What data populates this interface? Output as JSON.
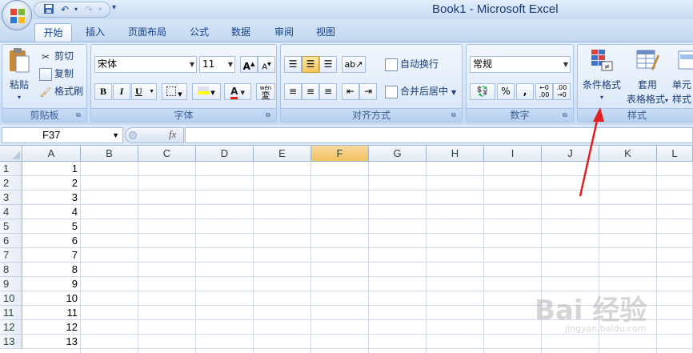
{
  "window": {
    "title": "Book1 - Microsoft Excel"
  },
  "quick_access": {
    "save_icon": "save-icon",
    "undo_icon": "undo-icon",
    "redo_icon": "redo-icon"
  },
  "tabs": [
    {
      "label": "开始",
      "active": true
    },
    {
      "label": "插入"
    },
    {
      "label": "页面布局"
    },
    {
      "label": "公式"
    },
    {
      "label": "数据"
    },
    {
      "label": "审阅"
    },
    {
      "label": "视图"
    }
  ],
  "clipboard": {
    "label": "剪贴板",
    "paste": "粘贴",
    "cut": "剪切",
    "copy": "复制",
    "format_painter": "格式刷"
  },
  "font": {
    "label": "字体",
    "name": "宋体",
    "size": "11",
    "bold": "B",
    "italic": "I",
    "underline": "U",
    "font_color_letter": "A",
    "grow": "A",
    "shrink": "A",
    "phonetic": "wén"
  },
  "alignment": {
    "label": "对齐方式",
    "wrap_text": "自动换行",
    "merge_center": "合并后居中"
  },
  "number": {
    "label": "数字",
    "format": "常规",
    "percent": "%",
    "comma": ",",
    "increase_decimal": ".00",
    "decrease_decimal": ".00"
  },
  "styles": {
    "label": "样式",
    "conditional_formatting": "条件格式",
    "format_table_line1": "套用",
    "format_table_line2": "表格格式",
    "cell_styles_line1": "单元",
    "cell_styles_line2": "样式"
  },
  "formula_bar": {
    "name_box": "F37",
    "fx": "fx",
    "value": ""
  },
  "grid": {
    "columns": [
      "A",
      "B",
      "C",
      "D",
      "E",
      "F",
      "G",
      "H",
      "I",
      "J",
      "K",
      "L"
    ],
    "selected_column": "F",
    "rows": [
      "1",
      "2",
      "3",
      "4",
      "5",
      "6",
      "7",
      "8",
      "9",
      "10",
      "11",
      "12",
      "13"
    ],
    "column_a_values": [
      "1",
      "2",
      "3",
      "4",
      "5",
      "6",
      "7",
      "8",
      "9",
      "10",
      "11",
      "12",
      "13"
    ]
  },
  "watermark": {
    "text": "Bai 经验",
    "sub": "jingyan.baidu.com"
  },
  "colors": {
    "ribbon_bg": "#d6e5f7",
    "accent": "#15428b",
    "selected_header": "#f1c15f",
    "annotation_arrow": "#e02020"
  }
}
